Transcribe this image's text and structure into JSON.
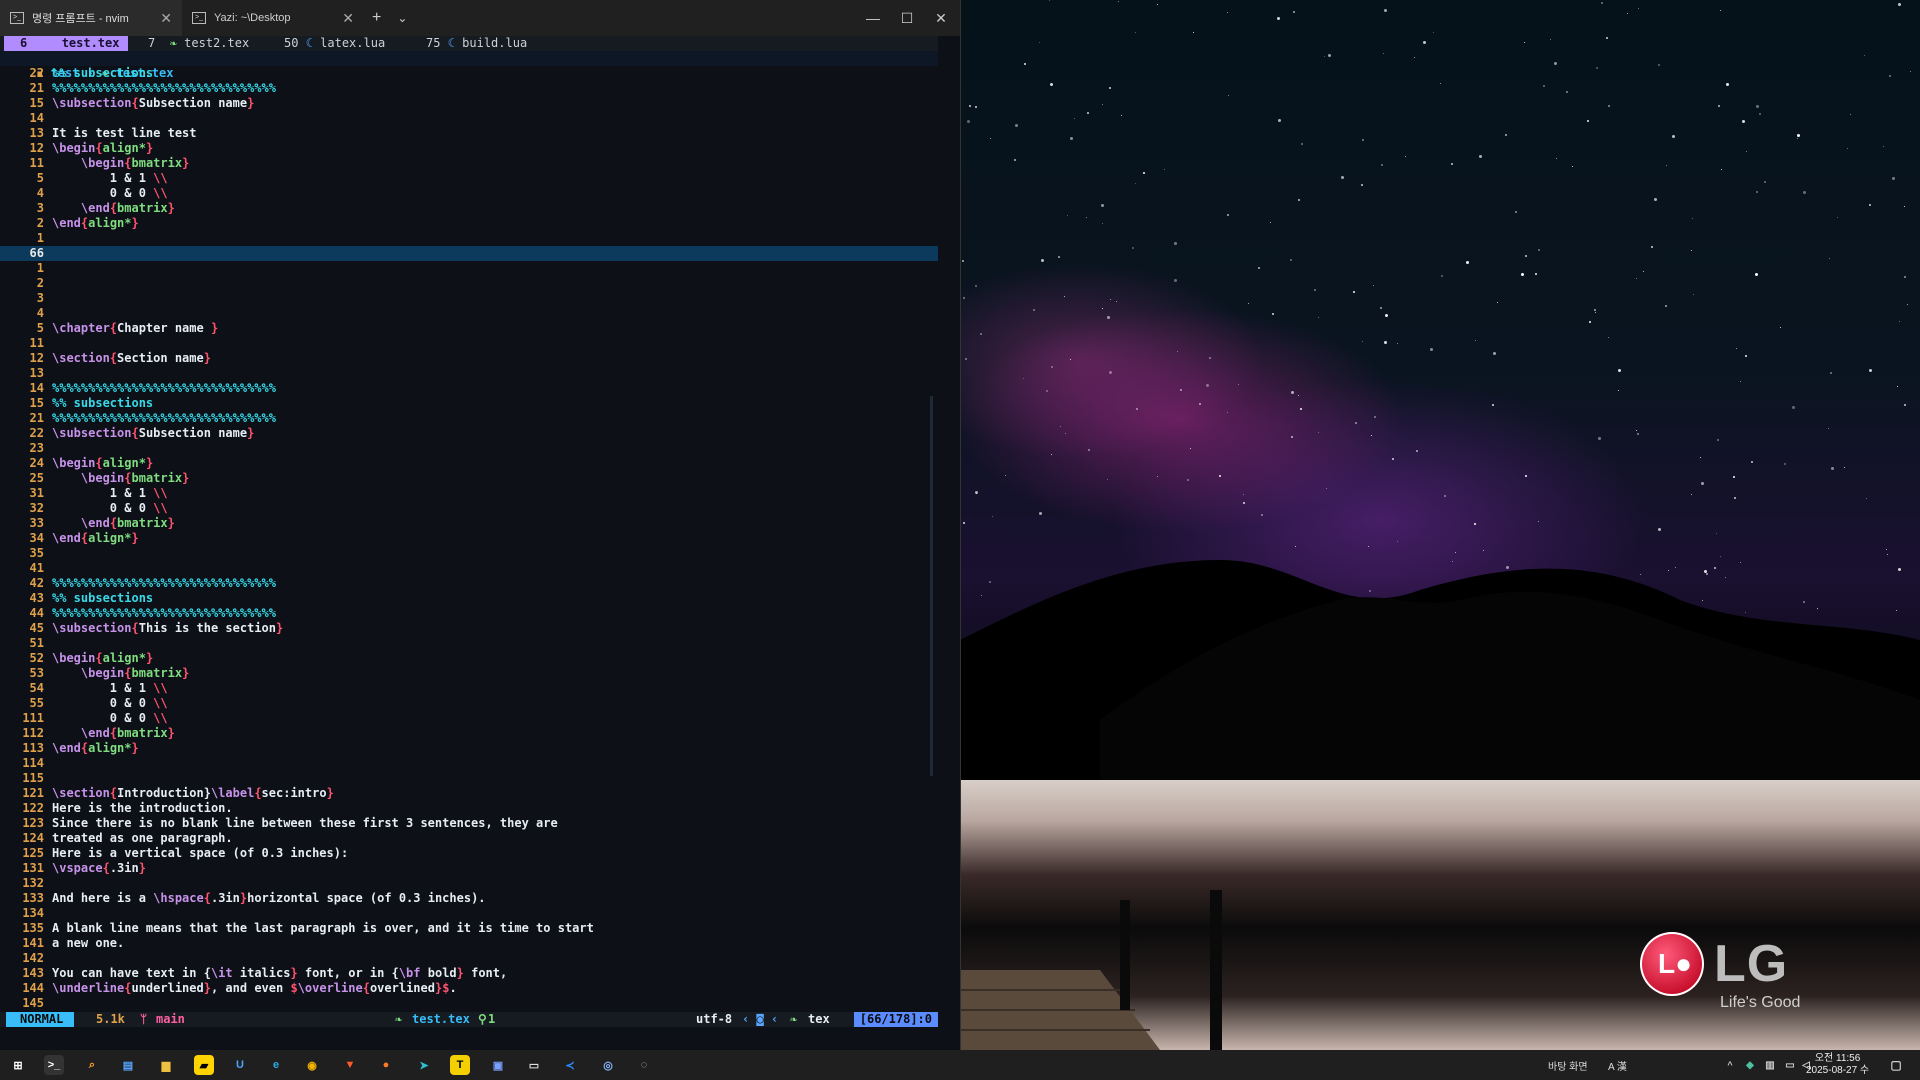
{
  "window": {
    "tabs": [
      {
        "label": "명령 프롬프트 - nvim"
      },
      {
        "label": "Yazi: ~\\Desktop"
      }
    ],
    "new_tab": "+",
    "dropdown": "⌄",
    "controls": {
      "minimize": "—",
      "maximize": "☐",
      "close": "✕"
    }
  },
  "bufferline": {
    "buffers": [
      {
        "index": "6",
        "name": "test.tex"
      },
      {
        "index": "7",
        "name": "test2.tex"
      },
      {
        "index": "50",
        "name": "latex.lua"
      },
      {
        "index": "75",
        "name": "build.lua"
      }
    ]
  },
  "breadcrumb": {
    "folder": "test",
    "file": "test.tex"
  },
  "editor": {
    "lines": [
      {
        "n": "22",
        "t": "%% subsections"
      },
      {
        "n": "21",
        "t": "%%%%%%%%%%%%%%%%%%%%%%%%%%%%%%%"
      },
      {
        "n": "15",
        "t": "\\subsection{Subsection name}"
      },
      {
        "n": "14",
        "t": ""
      },
      {
        "n": "13",
        "t": "It is test line test"
      },
      {
        "n": "12",
        "t": "\\begin{align*}"
      },
      {
        "n": "11",
        "t": "    \\begin{bmatrix}"
      },
      {
        "n": "5",
        "t": "        1 & 1 \\\\"
      },
      {
        "n": "4",
        "t": "        0 & 0 \\\\"
      },
      {
        "n": "3",
        "t": "    \\end{bmatrix}"
      },
      {
        "n": "2",
        "t": "\\end{align*}"
      },
      {
        "n": "1",
        "t": ""
      },
      {
        "n": "66",
        "t": "",
        "current": true
      },
      {
        "n": "1",
        "t": ""
      },
      {
        "n": "2",
        "t": ""
      },
      {
        "n": "3",
        "t": ""
      },
      {
        "n": "4",
        "t": ""
      },
      {
        "n": "5",
        "t": "\\chapter{Chapter name }"
      },
      {
        "n": "11",
        "t": ""
      },
      {
        "n": "12",
        "t": "\\section{Section name}"
      },
      {
        "n": "13",
        "t": ""
      },
      {
        "n": "14",
        "t": "%%%%%%%%%%%%%%%%%%%%%%%%%%%%%%%"
      },
      {
        "n": "15",
        "t": "%% subsections"
      },
      {
        "n": "21",
        "t": "%%%%%%%%%%%%%%%%%%%%%%%%%%%%%%%"
      },
      {
        "n": "22",
        "t": "\\subsection{Subsection name}"
      },
      {
        "n": "23",
        "t": ""
      },
      {
        "n": "24",
        "t": "\\begin{align*}"
      },
      {
        "n": "25",
        "t": "    \\begin{bmatrix}"
      },
      {
        "n": "31",
        "t": "        1 & 1 \\\\"
      },
      {
        "n": "32",
        "t": "        0 & 0 \\\\"
      },
      {
        "n": "33",
        "t": "    \\end{bmatrix}"
      },
      {
        "n": "34",
        "t": "\\end{align*}"
      },
      {
        "n": "35",
        "t": ""
      },
      {
        "n": "41",
        "t": ""
      },
      {
        "n": "42",
        "t": "%%%%%%%%%%%%%%%%%%%%%%%%%%%%%%%"
      },
      {
        "n": "43",
        "t": "%% subsections"
      },
      {
        "n": "44",
        "t": "%%%%%%%%%%%%%%%%%%%%%%%%%%%%%%%"
      },
      {
        "n": "45",
        "t": "\\subsection{This is the section}"
      },
      {
        "n": "51",
        "t": ""
      },
      {
        "n": "52",
        "t": "\\begin{align*}"
      },
      {
        "n": "53",
        "t": "    \\begin{bmatrix}"
      },
      {
        "n": "54",
        "t": "        1 & 1 \\\\"
      },
      {
        "n": "55",
        "t": "        0 & 0 \\\\"
      },
      {
        "n": "111",
        "t": "        0 & 0 \\\\"
      },
      {
        "n": "112",
        "t": "    \\end{bmatrix}"
      },
      {
        "n": "113",
        "t": "\\end{align*}"
      },
      {
        "n": "114",
        "t": ""
      },
      {
        "n": "115",
        "t": ""
      },
      {
        "n": "121",
        "t": "\\section{Introduction}\\label{sec:intro}"
      },
      {
        "n": "122",
        "t": "Here is the introduction."
      },
      {
        "n": "123",
        "t": "Since there is no blank line between these first 3 sentences, they are"
      },
      {
        "n": "124",
        "t": "treated as one paragraph."
      },
      {
        "n": "125",
        "t": "Here is a vertical space (of 0.3 inches):"
      },
      {
        "n": "131",
        "t": "\\vspace{.3in}"
      },
      {
        "n": "132",
        "t": ""
      },
      {
        "n": "133",
        "t": "And here is a \\hspace{.3in}horizontal space (of 0.3 inches)."
      },
      {
        "n": "134",
        "t": ""
      },
      {
        "n": "135",
        "t": "A blank line means that the last paragraph is over, and it is time to start"
      },
      {
        "n": "141",
        "t": "a new one."
      },
      {
        "n": "142",
        "t": ""
      },
      {
        "n": "143",
        "t": "You can have text in {\\it italics} font, or in {\\bf bold} font,"
      },
      {
        "n": "144",
        "t": "\\underline{underlined}, and even $\\overline{overlined}$."
      },
      {
        "n": "145",
        "t": ""
      }
    ]
  },
  "statusline": {
    "mode": "NORMAL",
    "size": "5.1k",
    "branch": "main",
    "file": "test.tex",
    "diagnostics": "1",
    "encoding": "utf-8",
    "filetype": "tex",
    "position": "[66/178]:0"
  },
  "wallpaper": {
    "brand": "LG",
    "slogan": "Life's Good"
  },
  "taskbar": {
    "tray_text": "바탕 화면",
    "ime": "A 漢",
    "time": "오전 11:56",
    "date": "2025-08-27 수"
  },
  "colors": {
    "accent": "#b18cff",
    "mode": "#38bdf8",
    "linenr": "#e0a14a",
    "cursorline": "#0b3a5c"
  }
}
